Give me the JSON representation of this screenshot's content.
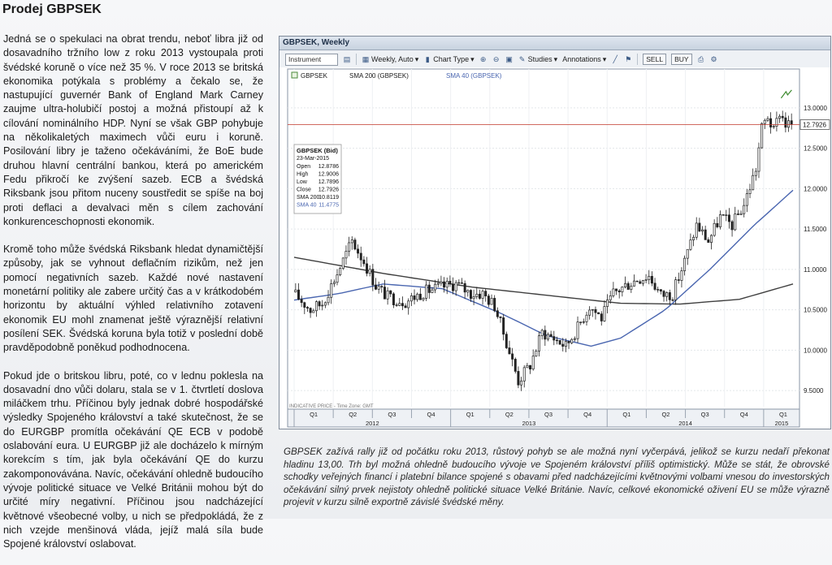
{
  "title": "Prodej GBPSEK",
  "paragraphs": [
    "Jedná se o spekulaci na obrat trendu, neboť libra již od dosavadního tržního low z roku 2013 vystoupala proti švédské koruně o více než 35 %. V roce 2013 se britská ekonomika potýkala s problémy a čekalo se, že nastupující guvernér Bank of England Mark Carney zaujme ultra-holubičí postoj a možná přistoupí až k cílování nominálního HDP. Nyní se však GBP pohybuje na několikaletých maximech vůči euru i koruně. Posilování libry je taženo očekáváními, že BoE bude druhou hlavní centrální bankou, která po americkém Fedu přikročí ke zvýšení sazeb. ECB a švédská Riksbank jsou přitom nuceny soustředit se spíše na boj proti deflaci a devalvaci měn s cílem zachování konkurenceschopnosti ekonomik.",
    "Kromě toho může švédská Riksbank hledat dynamičtější způsoby, jak se vyhnout deflačním rizikům, než jen pomocí negativních sazeb. Každé nové nastavení monetární politiky ale zabere určitý čas a v krátkodobém horizontu by aktuální výhled relativního zotavení ekonomik EU mohl znamenat ještě výraznější relativní posílení SEK. Švédská koruna byla totiž v poslední době pravděpodobně poněkud podhodnocena.",
    "Pokud jde o britskou libru, poté, co v lednu poklesla na dosavadní dno vůči dolaru, stala se v 1. čtvrtletí doslova miláčkem trhu. Příčinou byly jednak dobré hospodářské výsledky Spojeného království a také skutečnost, že se do EURGBP promítla očekávání QE ECB v podobě oslabování eura. U EURGBP již ale docházelo k mírným korekcím s tím, jak byla očekávání QE do kurzu zakomponovávána. Navíc, očekávání ohledně budoucího vývoje politické situace ve Velké Británii mohou být do určité míry negativní. Příčinou jsou nadcházející květnové všeobecné volby, u nich se předpokládá, že z nich vzejde menšinová vláda, jejíž malá síla bude Spojené království oslabovat."
  ],
  "caption": "GBPSEK zažívá rally již od počátku roku 2013, růstový pohyb se ale možná nyní vyčerpává, jelikož se kurzu nedaří překonat hladinu 13,00. Trh byl možná ohledně budoucího vývoje ve Spojeném království příliš optimistický. Může se stát, že obrovské schodky veřejných financí i platební bilance spojené s obavami před nadcházejícími květnovými volbami vnesou do investorských očekávání silný prvek nejistoty ohledně politické situace Velké Británie. Navíc, celkové ekonomické oživení EU se může výrazně projevit v kurzu silně exportně závislé švédské měny.",
  "window": {
    "title": "GBPSEK, Weekly",
    "toolbar": {
      "instrument_placeholder": "Instrument",
      "interval": "Weekly, Auto",
      "chart_type": "Chart Type",
      "studies": "Studies",
      "annotations": "Annotations",
      "sell": "SELL",
      "buy": "BUY"
    },
    "legend": [
      "GBPSEK",
      "SMA 200 (GBPSEK)",
      "SMA 40 (GBPSEK)"
    ],
    "footer_note": "INDICATIVE PRICE - Time Zone: GMT"
  },
  "chart_data": {
    "type": "candlestick",
    "title": "GBPSEK, Weekly",
    "price_axis": {
      "min": 9.3,
      "max": 13.3,
      "ticks": [
        9.5,
        10.0,
        10.5,
        11.0,
        11.5,
        12.0,
        12.5,
        13.0
      ],
      "tick_labels": [
        "9.5000",
        "10.0000",
        "10.5000",
        "11.0000",
        "11.5000",
        "12.0000",
        "12.5000",
        "13.0000"
      ]
    },
    "current_price": {
      "value": 12.7926,
      "label": "12.7926"
    },
    "time_axis": {
      "quarters": [
        "Q1",
        "Q2",
        "Q3",
        "Q4",
        "Q1",
        "Q2",
        "Q3",
        "Q4",
        "Q1",
        "Q2",
        "Q3",
        "Q4",
        "Q1"
      ],
      "years": [
        {
          "label": "2012",
          "quarter_start": 0,
          "quarter_end": 4
        },
        {
          "label": "2013",
          "quarter_start": 4,
          "quarter_end": 8
        },
        {
          "label": "2014",
          "quarter_start": 8,
          "quarter_end": 12
        },
        {
          "label": "2015",
          "quarter_start": 12,
          "quarter_end": 13
        }
      ],
      "total_weeks": 168
    },
    "anchors": [
      [
        0,
        10.72
      ],
      [
        6,
        10.5
      ],
      [
        10,
        10.58
      ],
      [
        15,
        10.95
      ],
      [
        20,
        11.35
      ],
      [
        24,
        11.1
      ],
      [
        28,
        10.8
      ],
      [
        32,
        10.66
      ],
      [
        38,
        10.6
      ],
      [
        44,
        10.72
      ],
      [
        50,
        10.78
      ],
      [
        55,
        10.82
      ],
      [
        60,
        10.7
      ],
      [
        64,
        10.7
      ],
      [
        68,
        10.55
      ],
      [
        72,
        10.1
      ],
      [
        76,
        9.62
      ],
      [
        80,
        9.82
      ],
      [
        84,
        10.22
      ],
      [
        88,
        10.15
      ],
      [
        92,
        10.05
      ],
      [
        96,
        10.28
      ],
      [
        100,
        10.55
      ],
      [
        104,
        10.4
      ],
      [
        108,
        10.7
      ],
      [
        112,
        10.8
      ],
      [
        116,
        10.88
      ],
      [
        120,
        10.92
      ],
      [
        124,
        10.68
      ],
      [
        128,
        10.7
      ],
      [
        132,
        11.1
      ],
      [
        136,
        11.55
      ],
      [
        140,
        11.35
      ],
      [
        144,
        11.65
      ],
      [
        148,
        11.55
      ],
      [
        152,
        11.8
      ],
      [
        156,
        12.25
      ],
      [
        158,
        12.75
      ],
      [
        160,
        12.9
      ],
      [
        162,
        12.7
      ],
      [
        164,
        12.95
      ],
      [
        166,
        12.8
      ],
      [
        168,
        12.79
      ]
    ],
    "sma200": [
      [
        0,
        11.15
      ],
      [
        30,
        10.95
      ],
      [
        60,
        10.78
      ],
      [
        90,
        10.66
      ],
      [
        110,
        10.58
      ],
      [
        130,
        10.57
      ],
      [
        150,
        10.63
      ],
      [
        168,
        10.82
      ]
    ],
    "sma40": [
      [
        0,
        10.62
      ],
      [
        15,
        10.7
      ],
      [
        30,
        10.82
      ],
      [
        50,
        10.76
      ],
      [
        70,
        10.45
      ],
      [
        85,
        10.18
      ],
      [
        100,
        10.05
      ],
      [
        110,
        10.15
      ],
      [
        125,
        10.5
      ],
      [
        140,
        11.0
      ],
      [
        155,
        11.55
      ],
      [
        168,
        11.98
      ]
    ],
    "info_box": {
      "title": "GBPSEK (Bid)",
      "date": "23-Mar-2015",
      "rows": [
        {
          "label": "Open",
          "value": "12.8786"
        },
        {
          "label": "High",
          "value": "12.9006"
        },
        {
          "label": "Low",
          "value": "12.7896"
        },
        {
          "label": "Close",
          "value": "12.7926"
        },
        {
          "label": "SMA 200",
          "value": "10.8119"
        },
        {
          "label": "SMA 40",
          "value": "11.4775"
        }
      ]
    },
    "colors": {
      "up": "#ffffff",
      "down": "#222222",
      "sma200": "#3f3f3f",
      "sma40": "#4a66b0",
      "price_line": "#c0392b"
    }
  }
}
